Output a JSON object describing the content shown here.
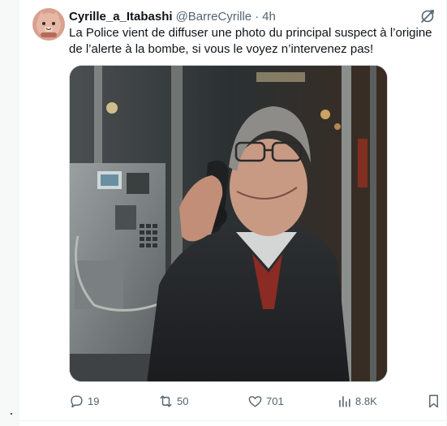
{
  "tweet": {
    "display_name": "Cyrille_a_Itabashi",
    "handle": "@BarreCyrille",
    "separator": "·",
    "time": "4h",
    "text": "La Police vient de diffuser une photo du principal suspect à l’origine de l’alerte à la bombe, si vous le voyez n’intervenez pas!",
    "avatar_icon": "cartoon-cat-avatar",
    "media_description_icon": "photo"
  },
  "actions": {
    "reply_count": "19",
    "retweet_count": "50",
    "like_count": "701",
    "views_count": "8.8K"
  },
  "colors": {
    "text_primary": "#0f1419",
    "text_secondary": "#536471",
    "border": "#cfd9de",
    "avatar_bg": "#c9826f"
  }
}
